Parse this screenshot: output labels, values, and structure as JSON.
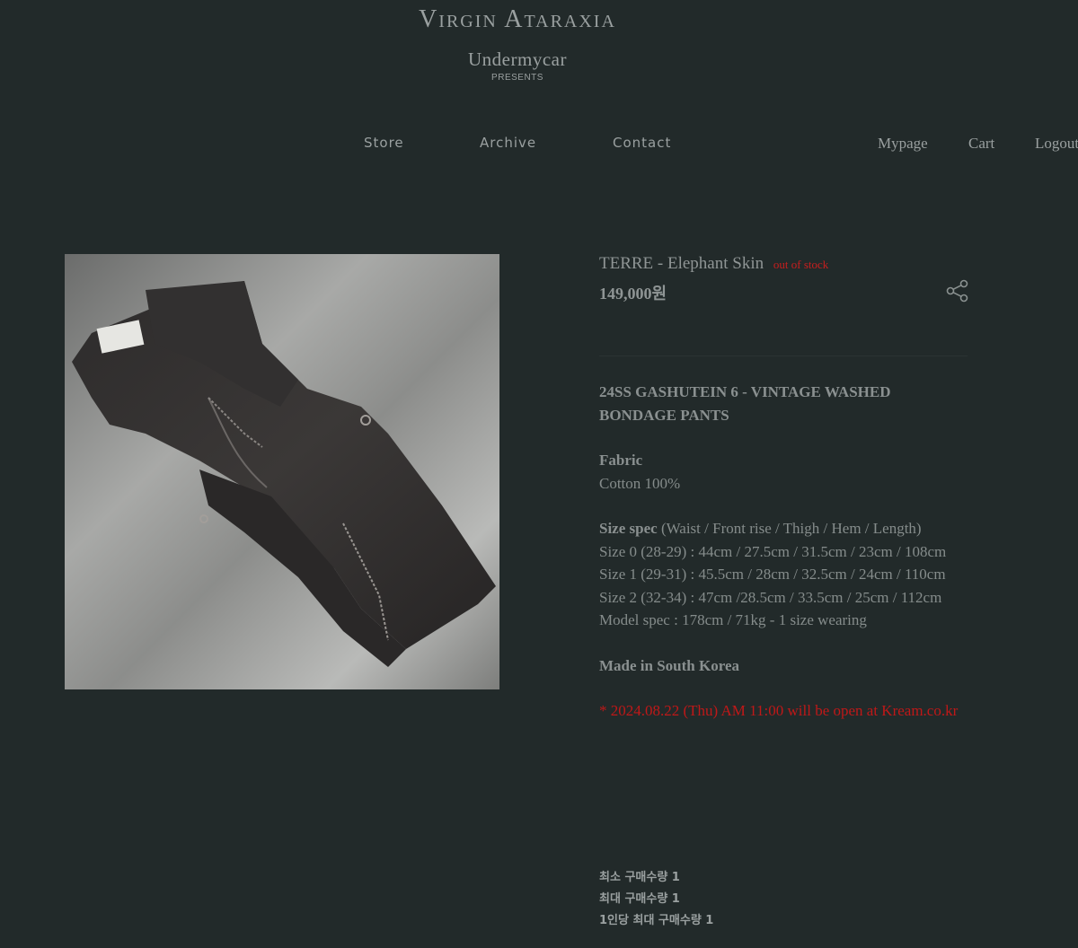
{
  "brand": {
    "title": "Virgin Ataraxia",
    "subtitle": "Undermycar",
    "presents": "PRESENTS"
  },
  "nav": {
    "store": "Store",
    "archive": "Archive",
    "contact": "Contact",
    "mypage": "Mypage",
    "cart": "Cart",
    "logout": "Logout"
  },
  "product": {
    "title": "TERRE - Elephant Skin",
    "status": "out of stock",
    "price": "149,000원",
    "share_icon": "share-icon",
    "headline": "24SS GASHUTEIN 6 - VINTAGE WASHED BONDAGE PANTS",
    "fabric_label": "Fabric",
    "fabric_value": "Cotton 100%",
    "size_label": "Size spec",
    "size_note": " (Waist / Front rise / Thigh / Hem / Length)",
    "sizes": [
      "Size 0 (28-29) : 44cm / 27.5cm / 31.5cm / 23cm / 108cm",
      "Size 1 (29-31) : 45.5cm / 28cm / 32.5cm / 24cm / 110cm",
      "Size 2 (32-34) : 47cm /28.5cm / 33.5cm / 25cm / 112cm",
      "Model spec : 178cm / 71kg - 1 size wearing"
    ],
    "origin": "Made in South Korea",
    "notice": "* 2024.08.22 (Thu) AM 11:00 will be open at Kream.co.kr",
    "min_purchase": "최소 구매수량 1",
    "max_purchase": "최대 구매수량 1",
    "per_person_max": "1인당 최대 구매수량 1"
  }
}
